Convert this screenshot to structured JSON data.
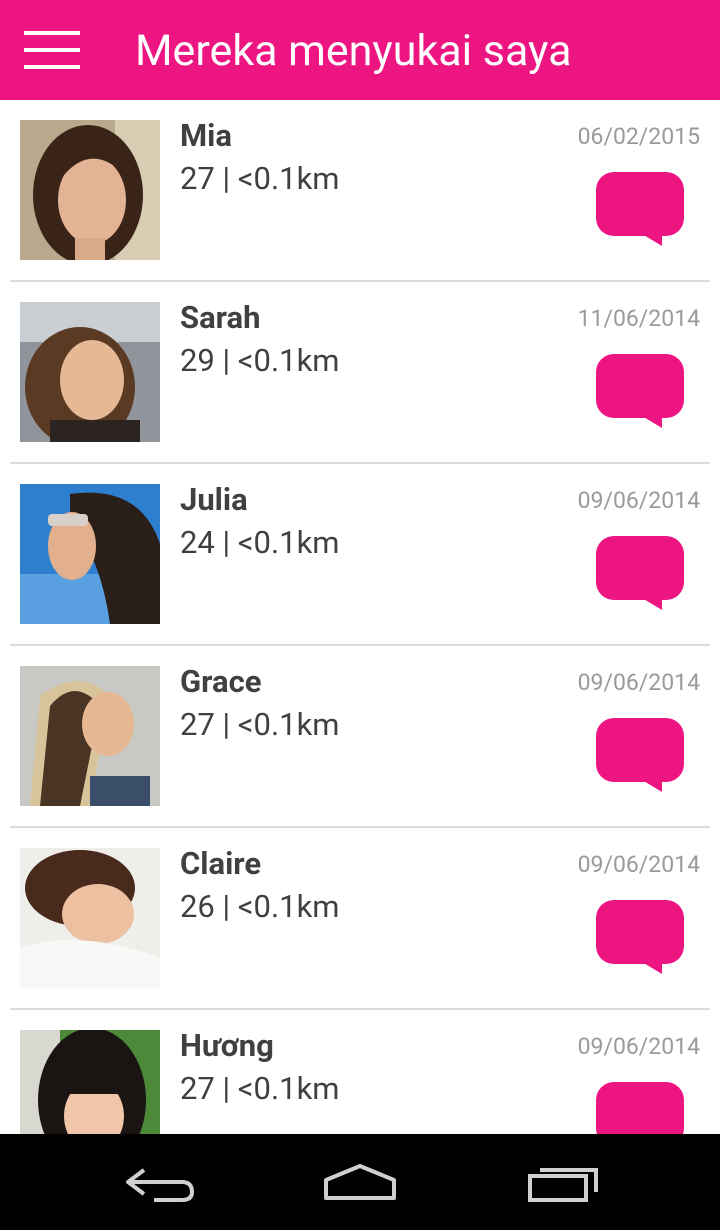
{
  "header": {
    "title": "Mereka menyukai saya",
    "accent_color": "#ed1582",
    "menu_icon": "hamburger-menu-icon"
  },
  "likes": [
    {
      "name": "Mia",
      "details": "27 | <0.1km",
      "date": "06/02/2015"
    },
    {
      "name": "Sarah",
      "details": "29 | <0.1km",
      "date": "11/06/2014"
    },
    {
      "name": "Julia",
      "details": "24 | <0.1km",
      "date": "09/06/2014"
    },
    {
      "name": "Grace",
      "details": "27 | <0.1km",
      "date": "09/06/2014"
    },
    {
      "name": "Claire",
      "details": "26 | <0.1km",
      "date": "09/06/2014"
    },
    {
      "name": "Hương",
      "details": "27 | <0.1km",
      "date": "09/06/2014"
    }
  ],
  "nav": {
    "back_icon": "back-arrow-icon",
    "home_icon": "home-icon",
    "recents_icon": "recent-apps-icon"
  }
}
